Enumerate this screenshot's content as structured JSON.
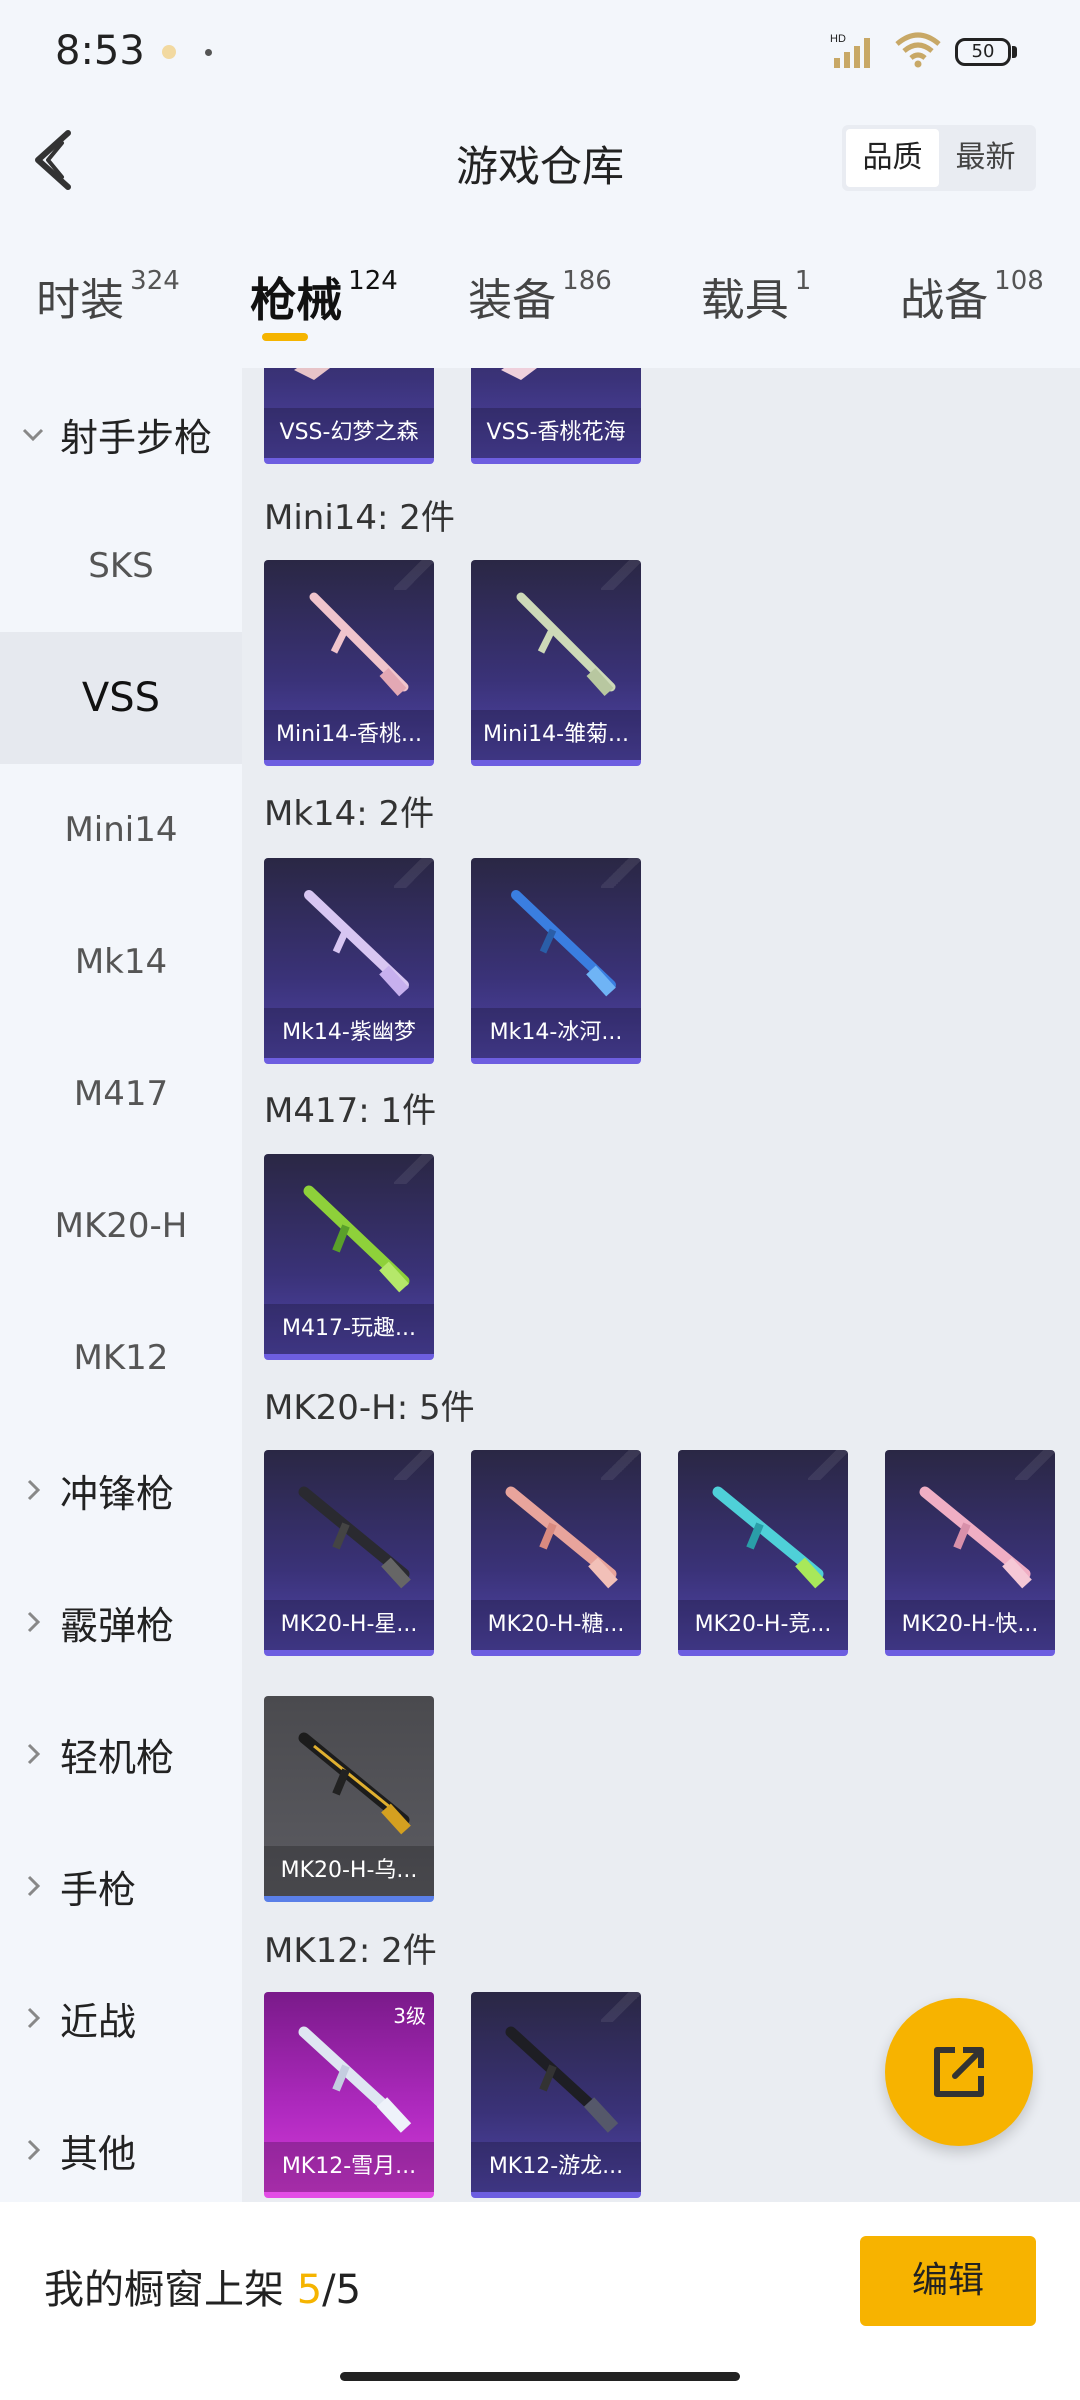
{
  "status": {
    "time": "8:53",
    "battery": "50"
  },
  "header": {
    "title": "游戏仓库",
    "sort": [
      "品质",
      "最新"
    ]
  },
  "tabs": [
    {
      "label": "时装",
      "count": "324"
    },
    {
      "label": "枪械",
      "count": "124"
    },
    {
      "label": "装备",
      "count": "186"
    },
    {
      "label": "载具",
      "count": "1"
    },
    {
      "label": "战备",
      "count": "108"
    }
  ],
  "sidebar": [
    {
      "label": "射手步枪"
    },
    {
      "label": "SKS"
    },
    {
      "label": "VSS"
    },
    {
      "label": "Mini14"
    },
    {
      "label": "Mk14"
    },
    {
      "label": "M417"
    },
    {
      "label": "MK20-H"
    },
    {
      "label": "MK12"
    },
    {
      "label": "冲锋枪"
    },
    {
      "label": "霰弹枪"
    },
    {
      "label": "轻机枪"
    },
    {
      "label": "手枪"
    },
    {
      "label": "近战"
    },
    {
      "label": "其他"
    }
  ],
  "groups": [
    {
      "title": "",
      "items": [
        "VSS-幻梦之森",
        "VSS-香桃花海"
      ]
    },
    {
      "title": "Mini14: 2件",
      "items": [
        "Mini14-香桃...",
        "Mini14-雏菊..."
      ]
    },
    {
      "title": "Mk14: 2件",
      "items": [
        "Mk14-紫幽梦",
        "Mk14-冰河..."
      ]
    },
    {
      "title": "M417: 1件",
      "items": [
        "M417-玩趣..."
      ]
    },
    {
      "title": "MK20-H: 5件",
      "items": [
        "MK20-H-星...",
        "MK20-H-糖...",
        "MK20-H-竞...",
        "MK20-H-快...",
        "MK20-H-乌..."
      ]
    },
    {
      "title": "MK12: 2件",
      "items": [
        "MK12-雪月...",
        "MK12-游龙..."
      ],
      "level": "3级"
    }
  ],
  "footer": {
    "label": "我的橱窗上架",
    "count": "5",
    "total": "/5",
    "edit": "编辑"
  }
}
